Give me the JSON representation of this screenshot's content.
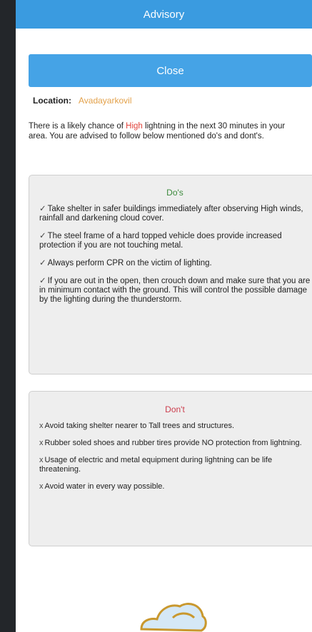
{
  "title": "Advisory",
  "close_label": "Close",
  "location": {
    "label": "Location:",
    "value": "Avadayarkovil"
  },
  "intro": {
    "before": "There is a likely chance of ",
    "highlight": "High",
    "after": " lightning in the next 30 minutes in your area. You are advised to follow below mentioned do's and dont's."
  },
  "dos": {
    "title": "Do's",
    "mark": "✓",
    "items": [
      "Take shelter in safer buildings immediately after observing High winds, rainfall and darkening cloud cover.",
      "The steel frame of a hard topped vehicle does provide increased protection if you are not touching metal.",
      "Always perform CPR on the victim of lighting.",
      "If you are out in the open, then crouch down and make sure that you are in minimum contact with the ground. This will control the possible damage by the lighting during the thunderstorm."
    ]
  },
  "donts": {
    "title": "Don't",
    "mark": "x",
    "items": [
      "Avoid taking shelter nearer to Tall trees and structures.",
      "Rubber soled shoes and rubber tires provide NO protection from lightning.",
      "Usage of electric and metal equipment during lightning can be life threatening.",
      "Avoid water in every way possible."
    ]
  },
  "colors": {
    "header": "#3a9be0",
    "button": "#45a3e6",
    "highlight": "#e0433b",
    "location_value": "#e3a14a",
    "dos_title": "#3c8a3c",
    "donts_title": "#cc3e4e"
  },
  "icons": {
    "bottom_art": "cloud-icon"
  }
}
